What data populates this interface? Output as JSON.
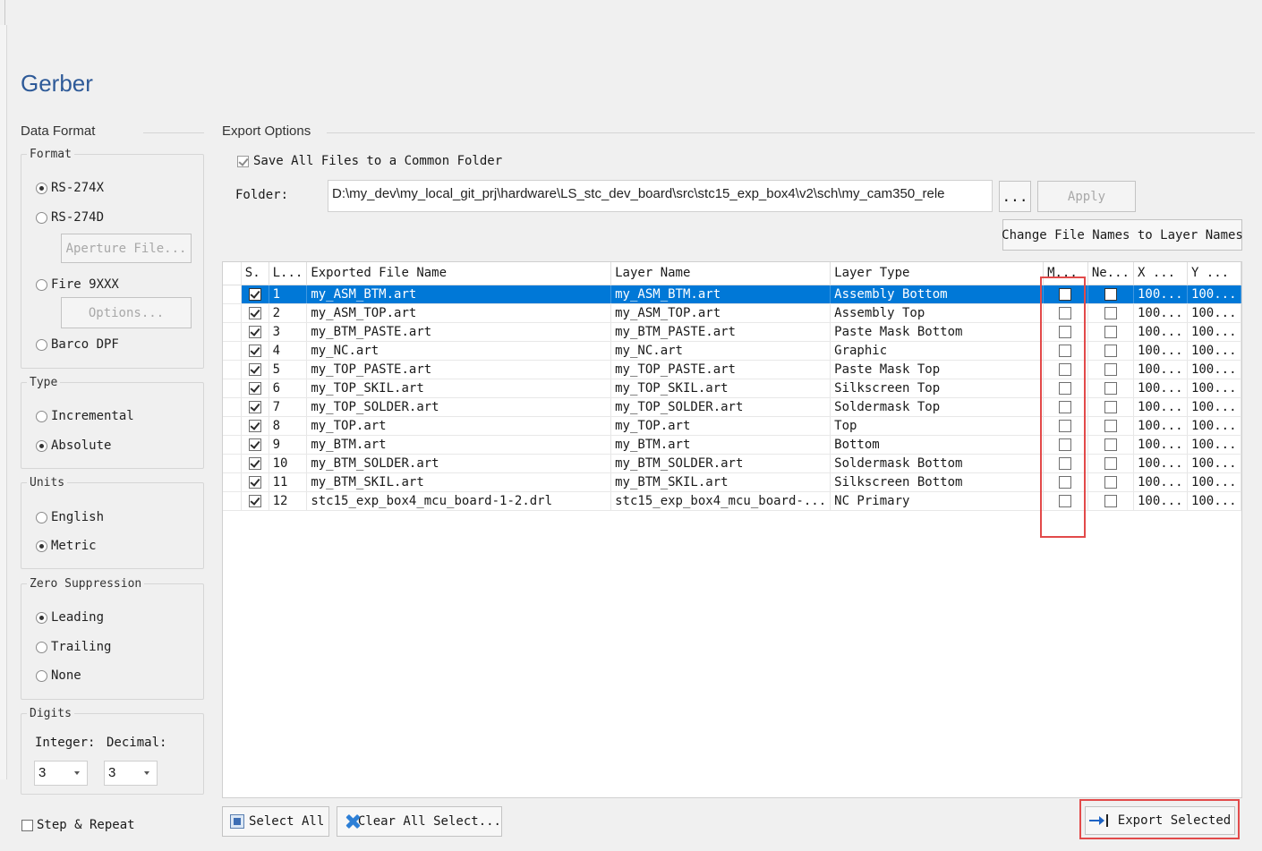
{
  "title": "Gerber",
  "data_format": {
    "label": "Data Format",
    "format": {
      "label": "Format",
      "options": [
        "RS-274X",
        "RS-274D",
        "Fire 9XXX",
        "Barco DPF"
      ],
      "selected": "RS-274X",
      "aperture_button": "Aperture File...",
      "options_button": "Options..."
    },
    "type": {
      "label": "Type",
      "options": [
        "Incremental",
        "Absolute"
      ],
      "selected": "Absolute"
    },
    "units": {
      "label": "Units",
      "options": [
        "English",
        "Metric"
      ],
      "selected": "Metric"
    },
    "zero_suppression": {
      "label": "Zero Suppression",
      "options": [
        "Leading",
        "Trailing",
        "None"
      ],
      "selected": "Leading"
    },
    "digits": {
      "label": "Digits",
      "integer_label": "Integer:",
      "decimal_label": "Decimal:",
      "integer": "3",
      "decimal": "3"
    },
    "step_repeat": {
      "label": "Step & Repeat",
      "checked": false
    }
  },
  "export_options": {
    "label": "Export Options",
    "save_common": {
      "label": "Save All Files to a Common Folder",
      "checked": true
    },
    "folder_label": "Folder:",
    "folder_value": "D:\\my_dev\\my_local_git_prj\\hardware\\LS_stc_dev_board\\src\\stc15_exp_box4\\v2\\sch\\my_cam350_rele",
    "browse_label": "...",
    "apply_label": "Apply",
    "change_names_label": "Change File Names to Layer Names"
  },
  "table": {
    "columns": [
      "S.",
      "L...",
      "Exported File Name",
      "Layer Name",
      "Layer Type",
      "M...",
      "Ne...",
      "X ...",
      "Y ..."
    ],
    "rows": [
      {
        "num": "1",
        "file": "my_ASM_BTM.art",
        "layer": "my_ASM_BTM.art",
        "type": "Assembly Bottom",
        "x": "100...",
        "y": "100..."
      },
      {
        "num": "2",
        "file": "my_ASM_TOP.art",
        "layer": "my_ASM_TOP.art",
        "type": "Assembly Top",
        "x": "100...",
        "y": "100..."
      },
      {
        "num": "3",
        "file": "my_BTM_PASTE.art",
        "layer": "my_BTM_PASTE.art",
        "type": "Paste Mask Bottom",
        "x": "100...",
        "y": "100..."
      },
      {
        "num": "4",
        "file": "my_NC.art",
        "layer": "my_NC.art",
        "type": "Graphic",
        "x": "100...",
        "y": "100..."
      },
      {
        "num": "5",
        "file": "my_TOP_PASTE.art",
        "layer": "my_TOP_PASTE.art",
        "type": "Paste Mask Top",
        "x": "100...",
        "y": "100..."
      },
      {
        "num": "6",
        "file": "my_TOP_SKIL.art",
        "layer": "my_TOP_SKIL.art",
        "type": "Silkscreen Top",
        "x": "100...",
        "y": "100..."
      },
      {
        "num": "7",
        "file": "my_TOP_SOLDER.art",
        "layer": "my_TOP_SOLDER.art",
        "type": "Soldermask Top",
        "x": "100...",
        "y": "100..."
      },
      {
        "num": "8",
        "file": "my_TOP.art",
        "layer": "my_TOP.art",
        "type": "Top",
        "x": "100...",
        "y": "100..."
      },
      {
        "num": "9",
        "file": "my_BTM.art",
        "layer": "my_BTM.art",
        "type": "Bottom",
        "x": "100...",
        "y": "100..."
      },
      {
        "num": "10",
        "file": "my_BTM_SOLDER.art",
        "layer": "my_BTM_SOLDER.art",
        "type": "Soldermask Bottom",
        "x": "100...",
        "y": "100..."
      },
      {
        "num": "11",
        "file": "my_BTM_SKIL.art",
        "layer": "my_BTM_SKIL.art",
        "type": "Silkscreen Bottom",
        "x": "100...",
        "y": "100..."
      },
      {
        "num": "12",
        "file": "stc15_exp_box4_mcu_board-1-2.drl",
        "layer": "stc15_exp_box4_mcu_board-...",
        "type": "NC Primary",
        "x": "100...",
        "y": "100..."
      }
    ]
  },
  "footer": {
    "select_all": "Select All",
    "clear_all": "Clear All Select...",
    "export_selected": "Export Selected"
  },
  "colors": {
    "title": "#2e5a98",
    "selection": "#0078d7",
    "highlight": "#e24a4a"
  }
}
